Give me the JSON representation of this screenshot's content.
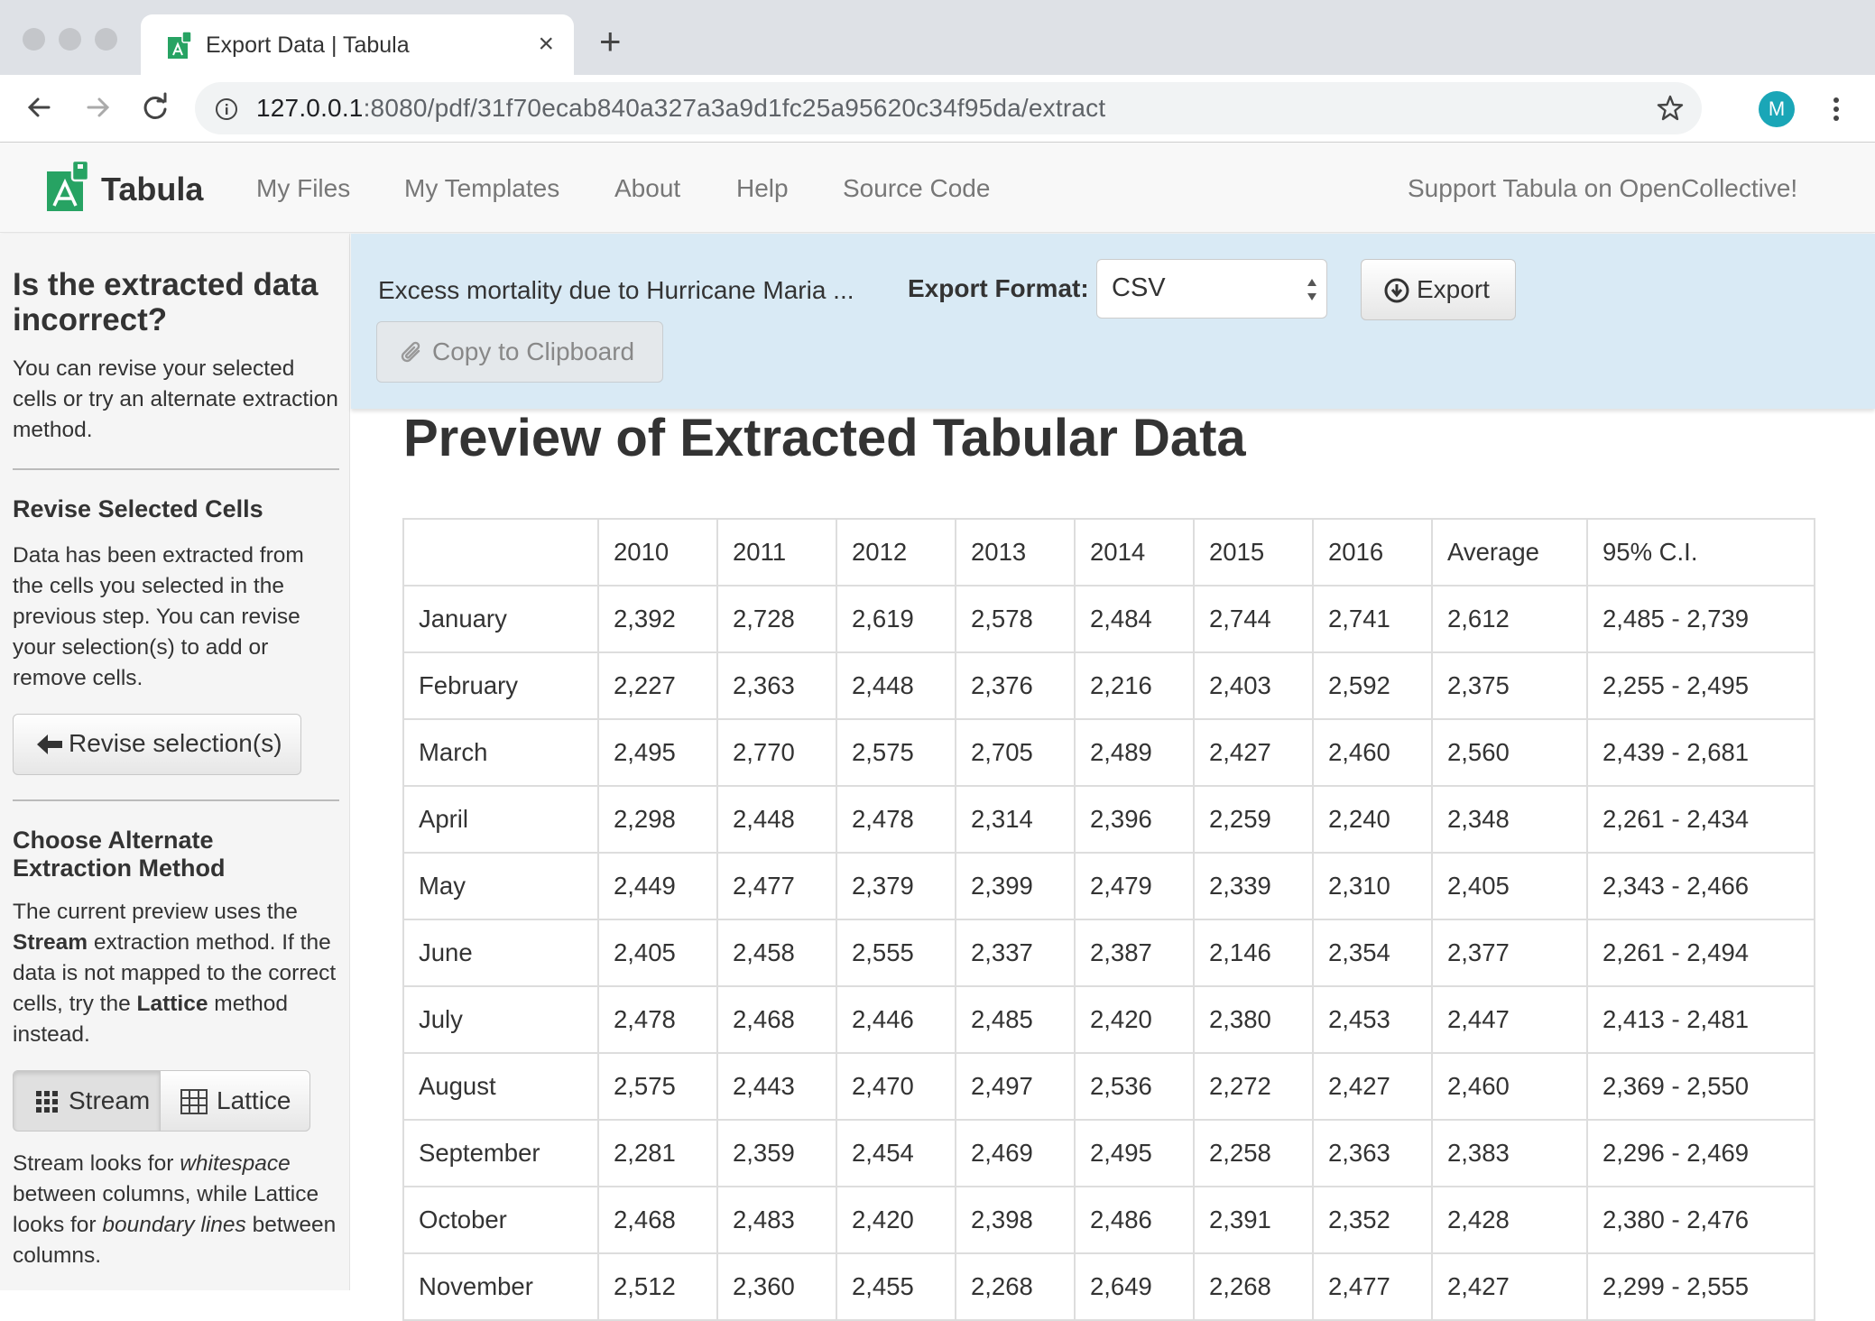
{
  "browser": {
    "tab_title": "Export Data | Tabula",
    "url_host": "127.0.0.1",
    "url_rest": ":8080/pdf/31f70ecab840a327a3a9d1fc25a95620c34f95da/extract",
    "avatar_letter": "M",
    "colors": {
      "tabstrip": "#dee1e6",
      "omnibox": "#f1f3f4",
      "avatar": "#1aa6b7"
    }
  },
  "navbar": {
    "brand": "Tabula",
    "links": [
      "My Files",
      "My Templates",
      "About",
      "Help",
      "Source Code"
    ],
    "support": "Support Tabula on OpenCollective!"
  },
  "sidebar": {
    "heading": "Is the extracted data incorrect?",
    "intro": "You can revise your selected cells or try an alternate extraction method.",
    "revise_heading": "Revise Selected Cells",
    "revise_text": "Data has been extracted from the cells you selected in the previous step. You can revise your selection(s) to add or remove cells.",
    "revise_button": "Revise selection(s)",
    "method_heading": "Choose Alternate Extraction Method",
    "method_text_1": "The current preview uses the ",
    "method_current": "Stream",
    "method_text_2": " extraction method. If the data is not mapped to the correct cells, try the ",
    "method_alt": "Lattice",
    "method_text_3": " method instead.",
    "stream_label": "Stream",
    "lattice_label": "Lattice",
    "explain_1": "Stream looks for ",
    "explain_em1": "whitespace",
    "explain_2": " between columns, while Lattice looks for ",
    "explain_em2": "boundary lines",
    "explain_3": " between columns."
  },
  "exportbar": {
    "doc_title": "Excess mortality due to Hurricane Maria ...",
    "format_label": "Export Format:",
    "format_value": "CSV",
    "export_button": "Export",
    "copy_button": "Copy to Clipboard",
    "color": "#d9eaf5"
  },
  "preview": {
    "title": "Preview of Extracted Tabular Data",
    "headers": [
      "",
      "2010",
      "2011",
      "2012",
      "2013",
      "2014",
      "2015",
      "2016",
      "Average",
      "95% C.I."
    ],
    "rows": [
      [
        "January",
        "2,392",
        "2,728",
        "2,619",
        "2,578",
        "2,484",
        "2,744",
        "2,741",
        "2,612",
        "2,485 - 2,739"
      ],
      [
        "February",
        "2,227",
        "2,363",
        "2,448",
        "2,376",
        "2,216",
        "2,403",
        "2,592",
        "2,375",
        "2,255 - 2,495"
      ],
      [
        "March",
        "2,495",
        "2,770",
        "2,575",
        "2,705",
        "2,489",
        "2,427",
        "2,460",
        "2,560",
        "2,439 - 2,681"
      ],
      [
        "April",
        "2,298",
        "2,448",
        "2,478",
        "2,314",
        "2,396",
        "2,259",
        "2,240",
        "2,348",
        "2,261 - 2,434"
      ],
      [
        "May",
        "2,449",
        "2,477",
        "2,379",
        "2,399",
        "2,479",
        "2,339",
        "2,310",
        "2,405",
        "2,343 - 2,466"
      ],
      [
        "June",
        "2,405",
        "2,458",
        "2,555",
        "2,337",
        "2,387",
        "2,146",
        "2,354",
        "2,377",
        "2,261 - 2,494"
      ],
      [
        "July",
        "2,478",
        "2,468",
        "2,446",
        "2,485",
        "2,420",
        "2,380",
        "2,453",
        "2,447",
        "2,413 - 2,481"
      ],
      [
        "August",
        "2,575",
        "2,443",
        "2,470",
        "2,497",
        "2,536",
        "2,272",
        "2,427",
        "2,460",
        "2,369 - 2,550"
      ],
      [
        "September",
        "2,281",
        "2,359",
        "2,454",
        "2,469",
        "2,495",
        "2,258",
        "2,363",
        "2,383",
        "2,296 - 2,469"
      ],
      [
        "October",
        "2,468",
        "2,483",
        "2,420",
        "2,398",
        "2,486",
        "2,391",
        "2,352",
        "2,428",
        "2,380 - 2,476"
      ],
      [
        "November",
        "2,512",
        "2,360",
        "2,455",
        "2,268",
        "2,649",
        "2,268",
        "2,477",
        "2,427",
        "2,299 - 2,555"
      ]
    ]
  }
}
